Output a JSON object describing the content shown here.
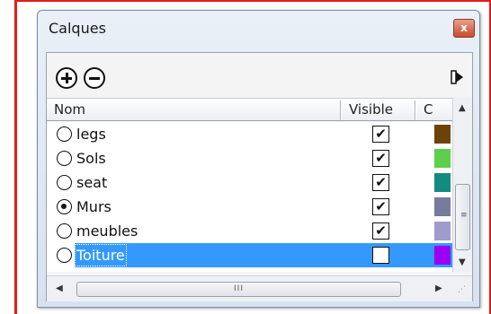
{
  "window": {
    "title": "Calques",
    "close_label": "x"
  },
  "toolbar": {
    "add_icon": "plus-circle-icon",
    "remove_icon": "minus-circle-icon",
    "details_icon": "arrow-right-icon"
  },
  "columns": {
    "name": "Nom",
    "visible": "Visible",
    "color": "C"
  },
  "layers": [
    {
      "name": "legs",
      "active": false,
      "visible": true,
      "color": "#6b4307",
      "selected": false
    },
    {
      "name": "Sols",
      "active": false,
      "visible": true,
      "color": "#5ccf4c",
      "selected": false
    },
    {
      "name": "seat",
      "active": false,
      "visible": true,
      "color": "#138b80",
      "selected": false
    },
    {
      "name": "Murs",
      "active": true,
      "visible": true,
      "color": "#777b9c",
      "selected": false
    },
    {
      "name": "meubles",
      "active": false,
      "visible": true,
      "color": "#a09bcf",
      "selected": false
    },
    {
      "name": "Toiture",
      "active": false,
      "visible": false,
      "color": "#9b00f0",
      "selected": true
    }
  ],
  "scrollbar": {
    "grip": "III",
    "selection_color": "#3399ff"
  }
}
